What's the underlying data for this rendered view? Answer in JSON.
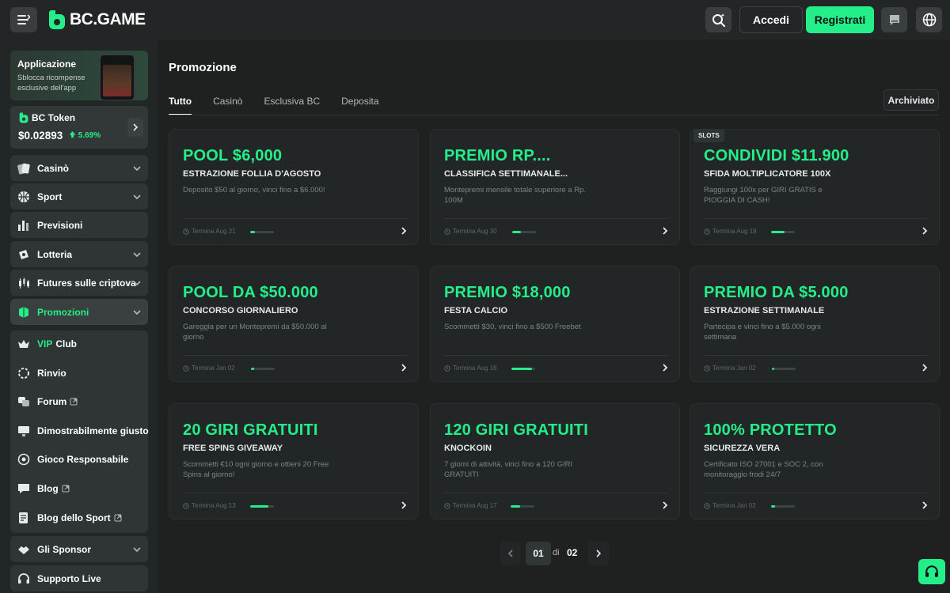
{
  "header": {
    "logo_text": "BC.GAME",
    "login_label": "Accedi",
    "register_label": "Registrati",
    "accent_color": "#24ee89"
  },
  "sidebar": {
    "app_card": {
      "title": "Applicazione",
      "subtitle": "Sblocca ricompense esclusive dell'app"
    },
    "token": {
      "name": "BC Token",
      "price": "$0.02893",
      "change": "5.69%"
    },
    "items": [
      {
        "label": "Casinò",
        "icon": "cards-icon",
        "expandable": true
      },
      {
        "label": "Sport",
        "icon": "basketball-icon",
        "expandable": true
      },
      {
        "label": "Previsioni",
        "icon": "bar-chart-icon",
        "expandable": false
      },
      {
        "label": "Lotteria",
        "icon": "lottery-icon",
        "expandable": true
      },
      {
        "label": "Futures sulle criptova",
        "icon": "candlestick-icon",
        "expandable": true
      },
      {
        "label": "Promozioni",
        "icon": "promo-icon",
        "expandable": true,
        "active": true
      }
    ],
    "group_items": [
      {
        "label_prefix": "VIP",
        "label": "Club",
        "icon": "crown-icon"
      },
      {
        "label": "Rinvio",
        "icon": "refresh-icon"
      },
      {
        "label": "Forum",
        "icon": "forum-icon",
        "external": true
      },
      {
        "label": "Dimostrabilmente giusto",
        "icon": "fair-icon"
      },
      {
        "label": "Gioco Responsabile",
        "icon": "responsible-icon"
      },
      {
        "label": "Blog",
        "icon": "blog-icon",
        "external": true
      },
      {
        "label": "Blog dello Sport",
        "icon": "sport-blog-icon",
        "external": true
      }
    ],
    "bottom_items": [
      {
        "label": "Gli Sponsor",
        "icon": "sponsor-icon",
        "expandable": true
      },
      {
        "label": "Supporto Live",
        "icon": "headset-icon",
        "expandable": false
      }
    ]
  },
  "main": {
    "title": "Promozione",
    "tabs": [
      {
        "label": "Tutto",
        "active": true
      },
      {
        "label": "Casinò"
      },
      {
        "label": "Esclusiva BC"
      },
      {
        "label": "Deposita"
      }
    ],
    "archived_label": "Archiviato",
    "promos": [
      {
        "title": "POOL $6,000",
        "subtitle": "ESTRAZIONE FOLLIA D'AGOSTO",
        "desc": "Deposito $50 al giorno, vinci fino a $6.000!",
        "ends": "Termina Aug 21",
        "progress": 0.2,
        "tag": ""
      },
      {
        "title": "PREMIO RP....",
        "subtitle": "CLASSIFICA SETTIMANALE...",
        "desc": "Montepremi mensile totale superiore a Rp. 100M",
        "ends": "Termina Aug 30",
        "progress": 0.35,
        "tag": ""
      },
      {
        "title": "CONDIVIDI $11.900",
        "subtitle": "SFIDA MOLTIPLICATORE 100X",
        "desc": "Raggiungi 100x per GIRI GRATIS e PIOGGIA DI CASH!",
        "ends": "Termina Aug 18",
        "progress": 0.55,
        "tag": "SLOTS"
      },
      {
        "title": "POOL DA $50.000",
        "subtitle": "CONCORSO GIORNALIERO",
        "desc": "Gareggia per un Montepremi da $50.000 al giorno",
        "ends": "Termina Jan 02",
        "progress": 0.12,
        "tag": ""
      },
      {
        "title": "PREMIO $18,000",
        "subtitle": "FESTA CALCIO",
        "desc": "Scommetti $30, vinci fino a $500 Freebet",
        "ends": "Termina Aug 16",
        "progress": 0.85,
        "tag": ""
      },
      {
        "title": "PREMIO DA $5.000",
        "subtitle": "ESTRAZIONE SETTIMANALE",
        "desc": "Partecipa e vinci fino a $5.000 ogni settimana",
        "ends": "Termina Jan 02",
        "progress": 0.1,
        "tag": ""
      },
      {
        "title": "20 GIRI GRATUITI",
        "subtitle": "FREE SPINS GIVEAWAY",
        "desc": "Scommetti €10 ogni giorno e ottieni 20 Free Spins al giorno!",
        "ends": "Termina Aug 13",
        "progress": 0.75,
        "tag": ""
      },
      {
        "title": "120 GIRI GRATUITI",
        "subtitle": "KNOCKOIN",
        "desc": "7 giorni di attività, vinci fino a 120 GIRI GRATUITI",
        "ends": "Termina Aug 17",
        "progress": 0.4,
        "tag": ""
      },
      {
        "title": "100% PROTETTO",
        "subtitle": "SICUREZZA VERA",
        "desc": "Certificato ISO 27001 e SOC 2, con monitoraggio frodi 24/7",
        "ends": "Termina Jan 02",
        "progress": 0.15,
        "tag": ""
      }
    ],
    "pagination": {
      "current": "01",
      "of_label": "di",
      "total": "02"
    }
  }
}
